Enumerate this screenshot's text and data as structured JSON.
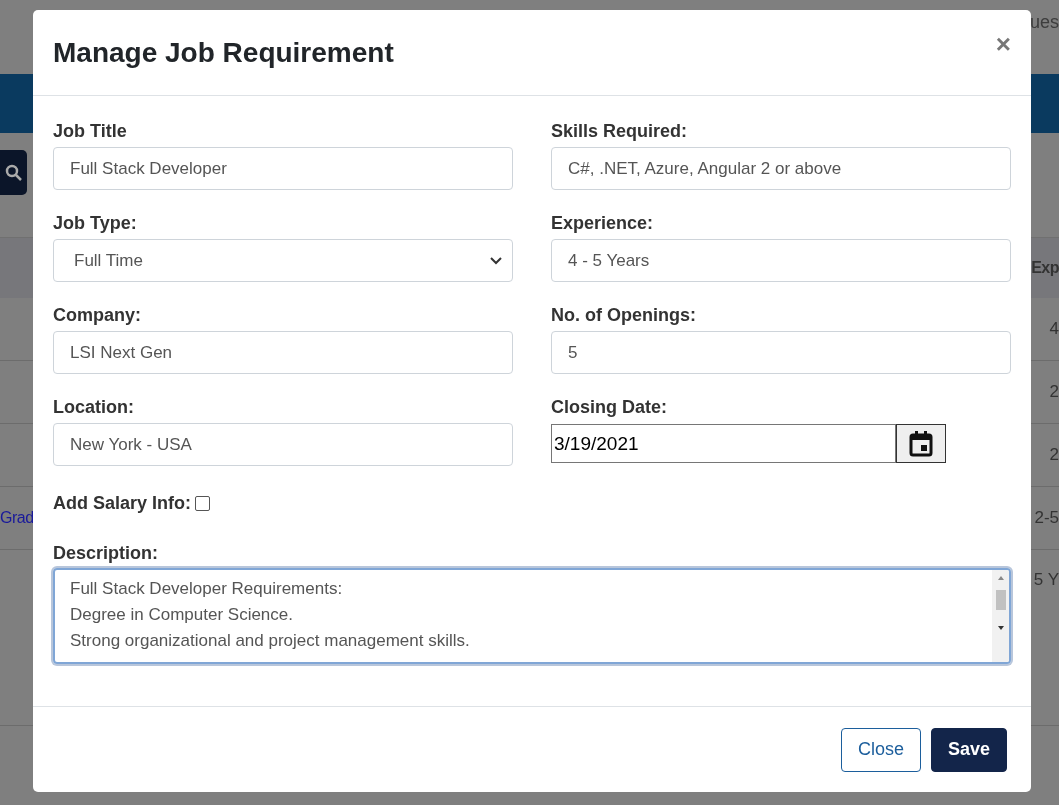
{
  "backdrop": {
    "top_text": "ues",
    "side_link": "Grad",
    "table_header": "Exp",
    "rows": [
      "4",
      "2",
      "2",
      "2-5",
      "5 Y"
    ]
  },
  "dialog": {
    "title": "Manage Job Requirement",
    "close_symbol": "×",
    "fields": [
      {
        "label": "Job Title",
        "kind": "text",
        "value": "Full Stack Developer"
      },
      {
        "label": "Skills Required:",
        "kind": "text",
        "value": "C#, .NET, Azure, Angular 2 or above"
      },
      {
        "label": "Job Type:",
        "kind": "select",
        "value": "Full Time"
      },
      {
        "label": "Experience:",
        "kind": "text",
        "value": "4 - 5 Years"
      },
      {
        "label": "Company:",
        "kind": "text",
        "value": "LSI Next Gen"
      },
      {
        "label": "No. of Openings:",
        "kind": "text",
        "value": "5"
      },
      {
        "label": "Location:",
        "kind": "text",
        "value": "New York - USA"
      },
      {
        "label": "Closing Date:",
        "kind": "date",
        "value": "3/19/2021"
      }
    ],
    "salary": {
      "label": "Add Salary Info:",
      "checked": false
    },
    "description": {
      "label": "Description:",
      "lines": [
        "Full Stack Developer Requirements:",
        "Degree in Computer Science.",
        "Strong organizational and project management skills."
      ]
    },
    "buttons": [
      {
        "label": "Close",
        "kind": "secondary"
      },
      {
        "label": "Save",
        "kind": "primary"
      }
    ]
  }
}
